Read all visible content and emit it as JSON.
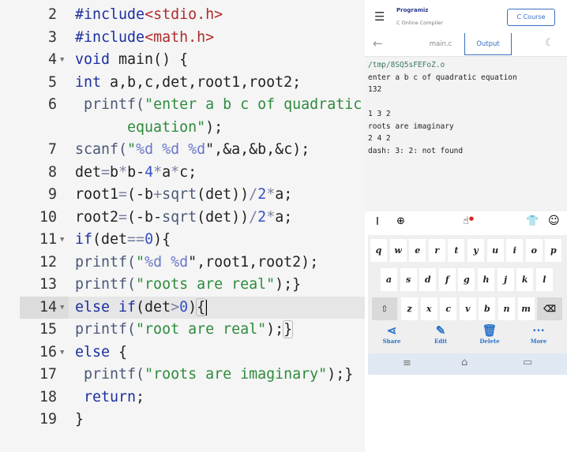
{
  "editor": {
    "active_line": 14,
    "lines": [
      {
        "n": "2",
        "fold": false,
        "t": [
          [
            "#include",
            "pp"
          ],
          [
            "<stdio.h>",
            "hd"
          ]
        ]
      },
      {
        "n": "3",
        "fold": false,
        "t": [
          [
            "#include",
            "pp"
          ],
          [
            "<math.h>",
            "hd"
          ]
        ]
      },
      {
        "n": "4",
        "fold": true,
        "t": [
          [
            "void",
            "kw"
          ],
          [
            " main() {",
            ""
          ]
        ]
      },
      {
        "n": "5",
        "fold": false,
        "t": [
          [
            "int",
            "kw"
          ],
          [
            " a,b,c,det,root1,root2;",
            ""
          ]
        ]
      },
      {
        "n": "6",
        "fold": false,
        "t": [
          [
            " printf(",
            "fn"
          ],
          [
            "\"enter a b c of quadratic",
            "st"
          ]
        ]
      },
      {
        "n": "",
        "fold": false,
        "t": [
          [
            "      equation\"",
            "st"
          ],
          [
            ");",
            ""
          ]
        ]
      },
      {
        "n": "7",
        "fold": false,
        "t": [
          [
            "scanf(",
            "fn"
          ],
          [
            "\"",
            "st"
          ],
          [
            "%d %d %d",
            "fmt"
          ],
          [
            "\"",
            ""
          ],
          [
            ",&a,&b,&c);",
            ""
          ]
        ]
      },
      {
        "n": "8",
        "fold": false,
        "t": [
          [
            "det",
            ""
          ],
          [
            "=",
            "op"
          ],
          [
            "b",
            ""
          ],
          [
            "*",
            "op"
          ],
          [
            "b-",
            ""
          ],
          [
            "4",
            "nm"
          ],
          [
            "*",
            "op"
          ],
          [
            "a",
            ""
          ],
          [
            "*",
            "op"
          ],
          [
            "c;",
            ""
          ]
        ]
      },
      {
        "n": "9",
        "fold": false,
        "t": [
          [
            "root1",
            ""
          ],
          [
            "=",
            "op"
          ],
          [
            "(-b",
            ""
          ],
          [
            "+",
            "op"
          ],
          [
            "sqrt",
            "fn"
          ],
          [
            "(det))",
            ""
          ],
          [
            "/",
            "op"
          ],
          [
            "2",
            "nm"
          ],
          [
            "*",
            "op"
          ],
          [
            "a;",
            ""
          ]
        ]
      },
      {
        "n": "10",
        "fold": false,
        "t": [
          [
            "root2",
            ""
          ],
          [
            "=",
            "op"
          ],
          [
            "(-b-",
            ""
          ],
          [
            "sqrt",
            "fn"
          ],
          [
            "(det))",
            ""
          ],
          [
            "/",
            "op"
          ],
          [
            "2",
            "nm"
          ],
          [
            "*",
            "op"
          ],
          [
            "a;",
            ""
          ]
        ]
      },
      {
        "n": "11",
        "fold": true,
        "t": [
          [
            "if",
            "kw"
          ],
          [
            "(det",
            ""
          ],
          [
            "==",
            "op"
          ],
          [
            "0",
            "nm"
          ],
          [
            "){",
            ""
          ]
        ]
      },
      {
        "n": "12",
        "fold": false,
        "t": [
          [
            "printf(",
            "fn"
          ],
          [
            "\"",
            "st"
          ],
          [
            "%d %d",
            "fmt"
          ],
          [
            "\"",
            ""
          ],
          [
            ",root1,root2);",
            ""
          ]
        ]
      },
      {
        "n": "13",
        "fold": false,
        "t": [
          [
            "printf(",
            "fn"
          ],
          [
            "\"roots are real\"",
            "st"
          ],
          [
            ");}",
            ""
          ]
        ]
      },
      {
        "n": "14",
        "fold": true,
        "t": [
          [
            "else if",
            "kw"
          ],
          [
            "(det",
            ""
          ],
          [
            ">",
            "op"
          ],
          [
            "0",
            "nm"
          ],
          [
            ")",
            ""
          ],
          [
            "{",
            "brk"
          ],
          [
            "",
            "cursor"
          ]
        ]
      },
      {
        "n": "15",
        "fold": false,
        "t": [
          [
            "printf(",
            "fn"
          ],
          [
            "\"root are real\"",
            "st"
          ],
          [
            ");",
            ""
          ],
          [
            "}",
            "brk"
          ]
        ]
      },
      {
        "n": "16",
        "fold": true,
        "t": [
          [
            "else",
            "kw"
          ],
          [
            " {",
            ""
          ]
        ]
      },
      {
        "n": "17",
        "fold": false,
        "t": [
          [
            " printf(",
            "fn"
          ],
          [
            "\"roots are imaginary\"",
            "st"
          ],
          [
            ");}",
            ""
          ]
        ]
      },
      {
        "n": "18",
        "fold": false,
        "t": [
          [
            " return",
            "kw"
          ],
          [
            ";",
            ""
          ]
        ]
      },
      {
        "n": "19",
        "fold": false,
        "t": [
          [
            "}",
            ""
          ]
        ]
      }
    ]
  },
  "header": {
    "brand": "Programiz",
    "subtitle": "C Online Compiler",
    "course_button": "C Course",
    "menu_icon": "hamburger-icon"
  },
  "tabs": {
    "file": "main.c",
    "output": "Output",
    "back_icon": "arrow-left-icon",
    "theme_icon": "moon-icon"
  },
  "output": {
    "lines": [
      "/tmp/8SQ5sFEFoZ.o",
      "enter a b c of quadratic equation",
      "132",
      "",
      "1 3 2",
      "roots are imaginary",
      "2 4 2",
      "dash: 3: 2: not found"
    ]
  },
  "keyboard": {
    "row1": [
      "q",
      "w",
      "e",
      "r",
      "t",
      "y",
      "u",
      "i",
      "o",
      "p"
    ],
    "row2": [
      "a",
      "s",
      "d",
      "f",
      "g",
      "h",
      "j",
      "k",
      "l"
    ],
    "row3": [
      "z",
      "x",
      "c",
      "v",
      "b",
      "n",
      "m"
    ],
    "actions": [
      {
        "label": "Share",
        "icon": "share-icon"
      },
      {
        "label": "Edit",
        "icon": "pencil-icon"
      },
      {
        "label": "Delete",
        "icon": "trash-icon"
      },
      {
        "label": "More",
        "icon": "more-icon"
      }
    ],
    "accent": "#2a74c8"
  }
}
